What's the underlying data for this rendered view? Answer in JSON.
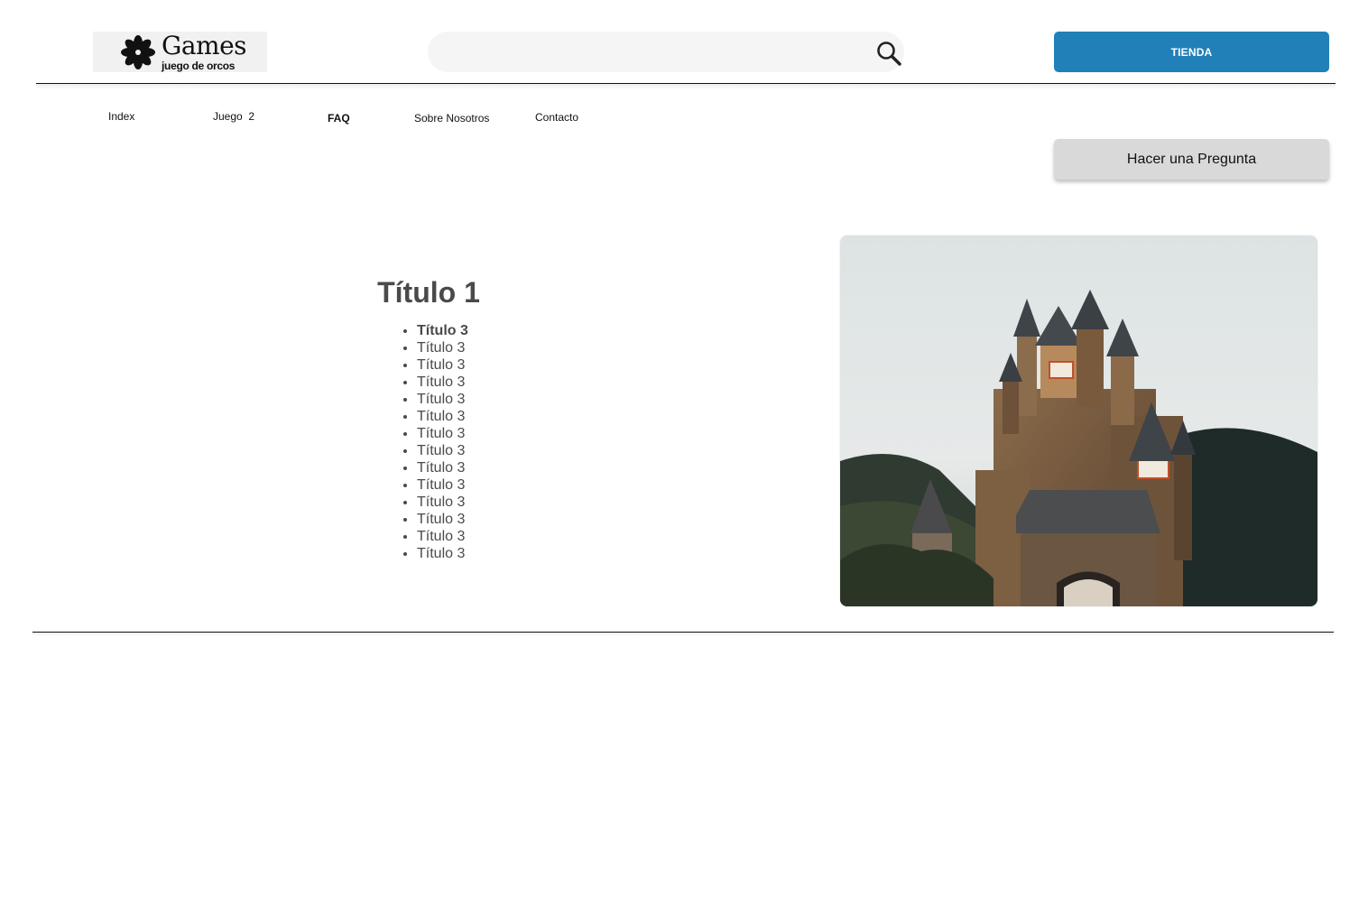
{
  "brand": {
    "title": "Games",
    "subtitle": "juego de orcos"
  },
  "search": {
    "value": "",
    "placeholder": "",
    "icon": "search-icon"
  },
  "header": {
    "store_label": "TIENDA",
    "store_color": "#2180b8"
  },
  "nav": {
    "items": [
      {
        "label": "Index"
      },
      {
        "label": "Juego  2"
      },
      {
        "label": "FAQ",
        "active": true
      },
      {
        "label": "Sobre Nosotros"
      },
      {
        "label": "Contacto"
      }
    ]
  },
  "actions": {
    "ask_label": "Hacer una Pregunta"
  },
  "main": {
    "heading": "Título 1",
    "topics": [
      "Título 3",
      "Título 3",
      "Título 3",
      "Título 3",
      "Título 3",
      "Título 3",
      "Título 3",
      "Título 3",
      "Título 3",
      "Título 3",
      "Título 3",
      "Título 3",
      "Título 3",
      "Título 3"
    ],
    "image_subject": "castle-photo"
  }
}
